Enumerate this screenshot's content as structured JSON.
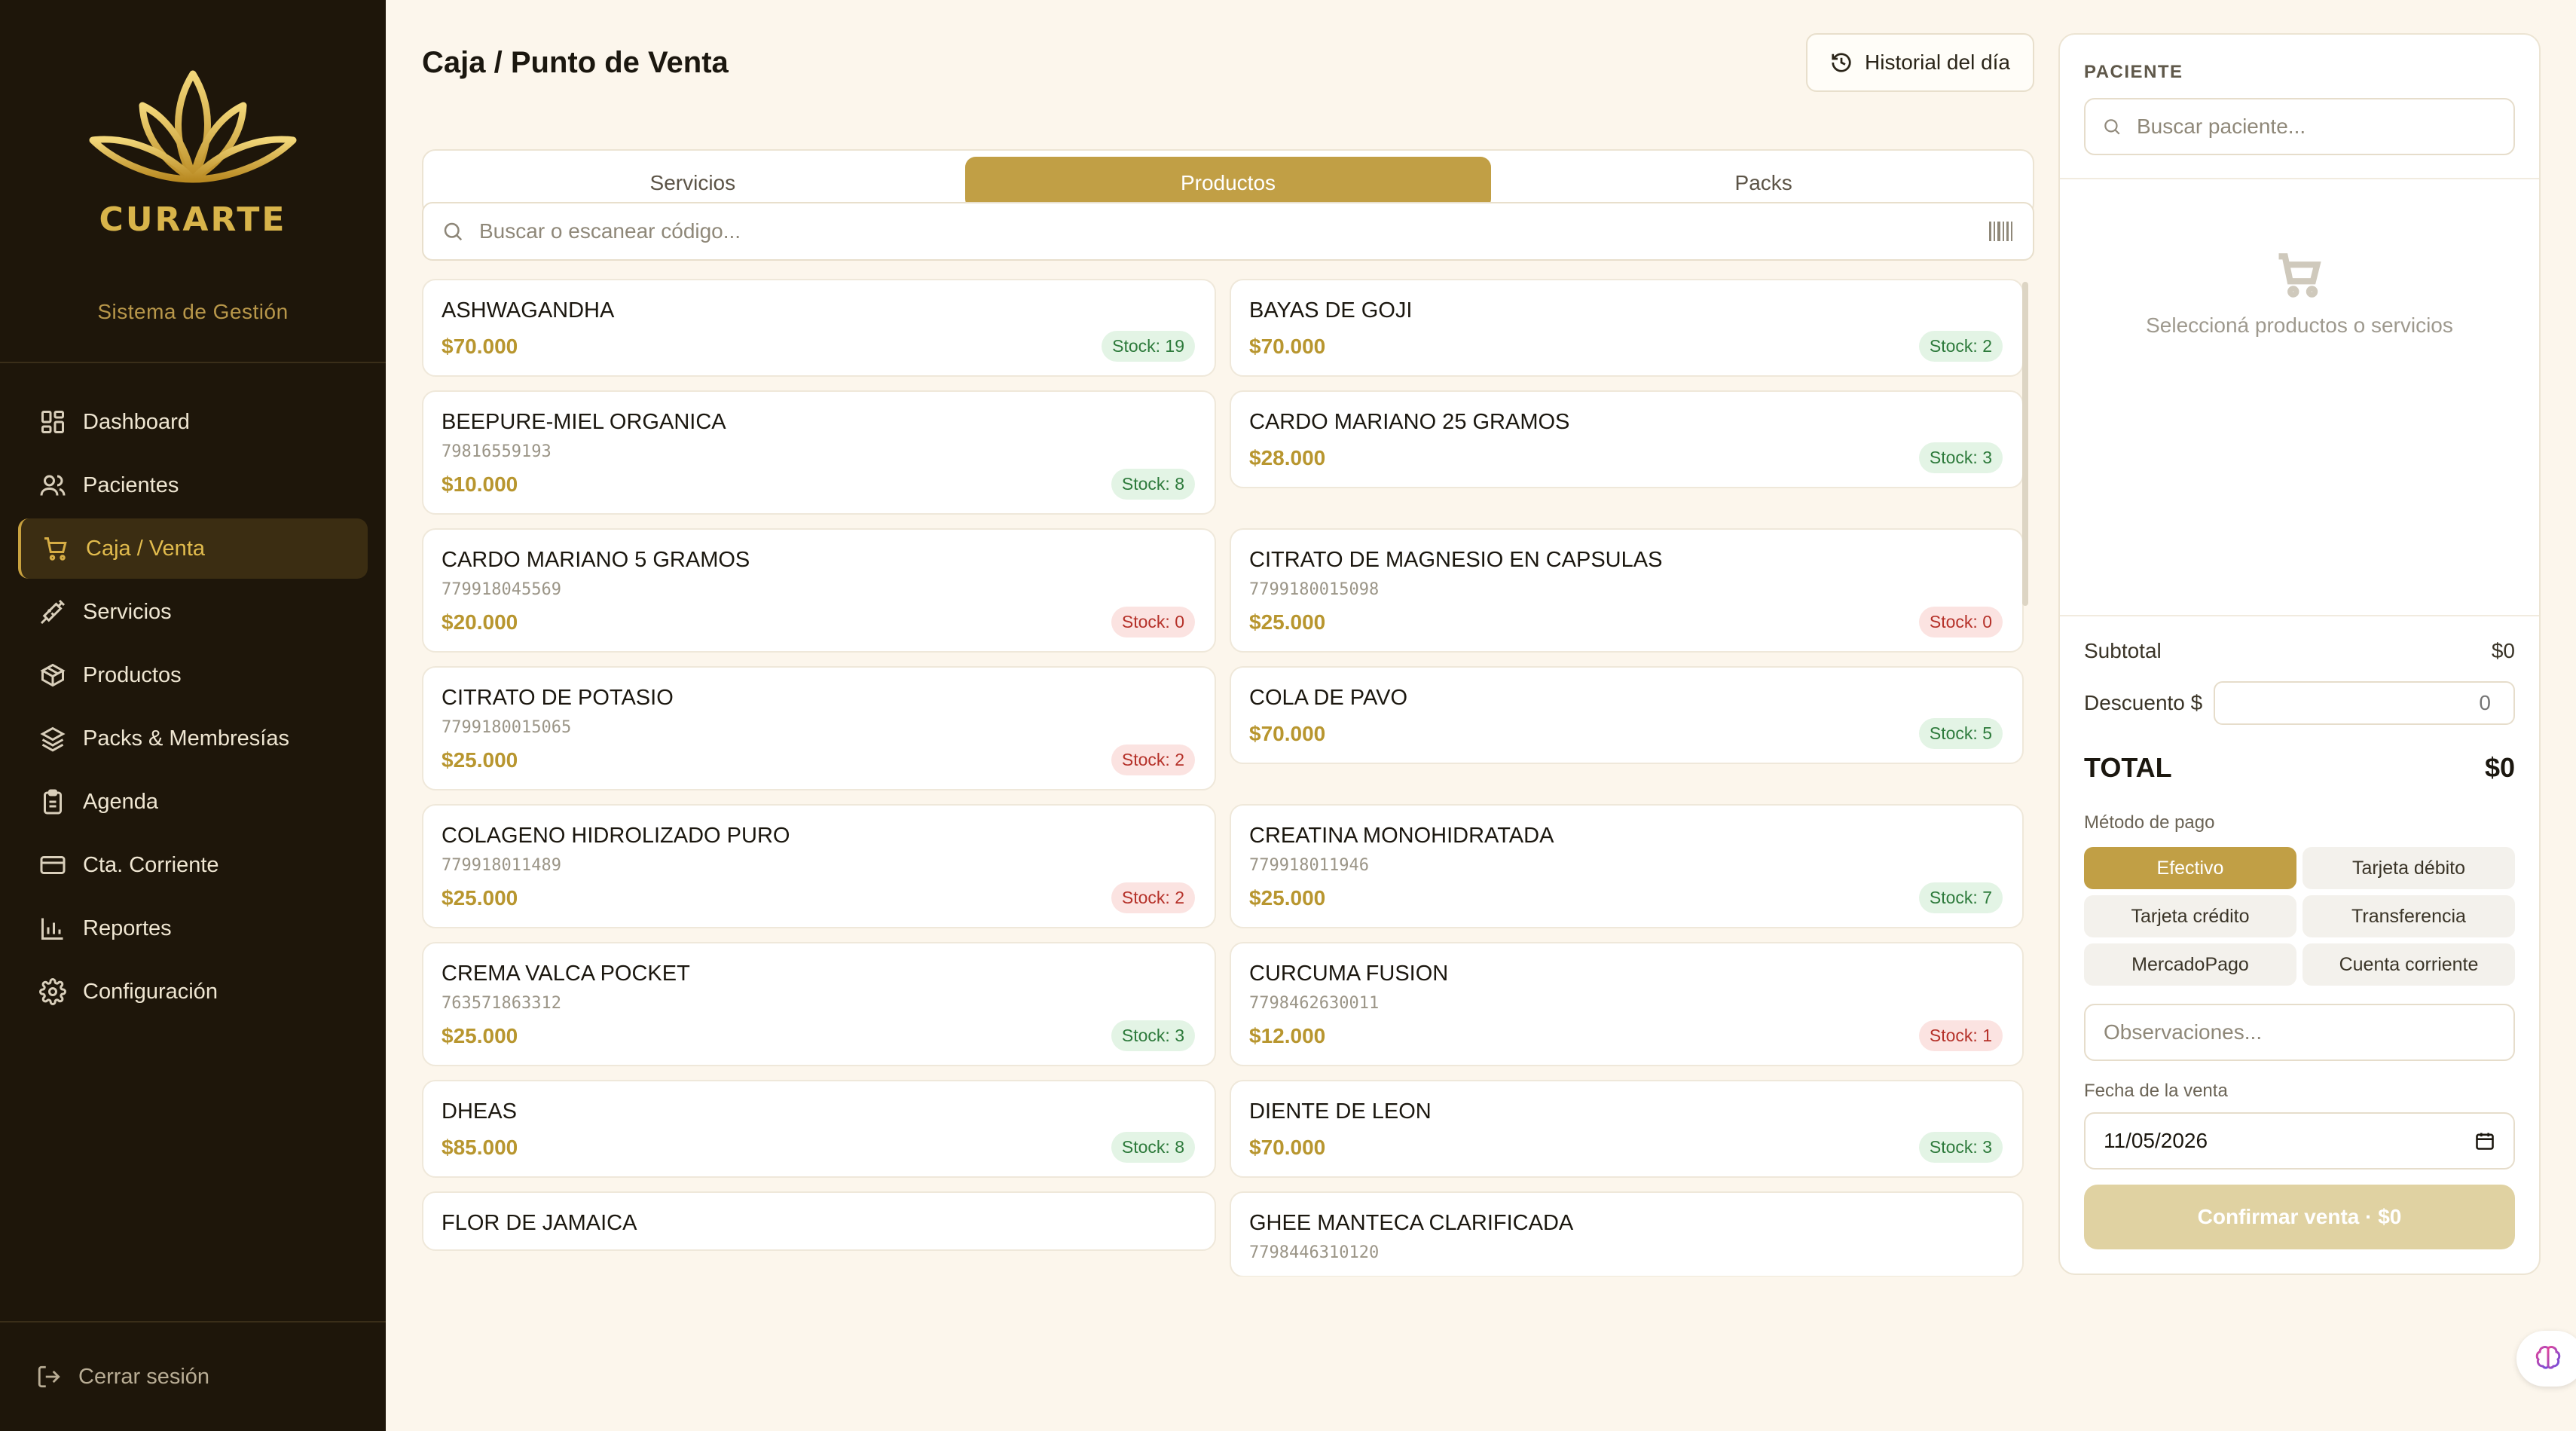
{
  "brand": {
    "name": "CURARTE",
    "subtitle": "Sistema de Gestión",
    "accent": "#c19f45"
  },
  "sidebar": {
    "items": [
      {
        "label": "Dashboard",
        "icon": "dashboard-icon",
        "active": false
      },
      {
        "label": "Pacientes",
        "icon": "users-icon",
        "active": false
      },
      {
        "label": "Caja / Venta",
        "icon": "cart-icon",
        "active": true
      },
      {
        "label": "Servicios",
        "icon": "syringe-icon",
        "active": false
      },
      {
        "label": "Productos",
        "icon": "box-icon",
        "active": false
      },
      {
        "label": "Packs & Membresías",
        "icon": "layers-icon",
        "active": false
      },
      {
        "label": "Agenda",
        "icon": "clipboard-icon",
        "active": false
      },
      {
        "label": "Cta. Corriente",
        "icon": "credit-card-icon",
        "active": false
      },
      {
        "label": "Reportes",
        "icon": "bar-chart-icon",
        "active": false
      },
      {
        "label": "Configuración",
        "icon": "gear-icon",
        "active": false
      }
    ],
    "logout_label": "Cerrar sesión"
  },
  "header": {
    "title": "Caja / Punto de Venta",
    "history_label": "Historial del día"
  },
  "tabs": [
    {
      "label": "Servicios",
      "active": false
    },
    {
      "label": "Productos",
      "active": true
    },
    {
      "label": "Packs",
      "active": false
    }
  ],
  "search": {
    "placeholder": "Buscar o escanear código..."
  },
  "products": [
    {
      "name": "ASHWAGANDHA",
      "code": "",
      "price": "$70.000",
      "stock": "Stock: 19",
      "status": "ok"
    },
    {
      "name": "BAYAS DE GOJI",
      "code": "",
      "price": "$70.000",
      "stock": "Stock: 2",
      "status": "ok"
    },
    {
      "name": "BEEPURE-MIEL ORGANICA",
      "code": "79816559193",
      "price": "$10.000",
      "stock": "Stock: 8",
      "status": "ok"
    },
    {
      "name": "CARDO MARIANO 25 GRAMOS",
      "code": "",
      "price": "$28.000",
      "stock": "Stock: 3",
      "status": "ok"
    },
    {
      "name": "CARDO MARIANO 5 GRAMOS",
      "code": "779918045569",
      "price": "$20.000",
      "stock": "Stock: 0",
      "status": "out"
    },
    {
      "name": "CITRATO DE MAGNESIO EN CAPSULAS",
      "code": "7799180015098",
      "price": "$25.000",
      "stock": "Stock: 0",
      "status": "out"
    },
    {
      "name": "CITRATO DE POTASIO",
      "code": "7799180015065",
      "price": "$25.000",
      "stock": "Stock: 2",
      "status": "out"
    },
    {
      "name": "COLA DE PAVO",
      "code": "",
      "price": "$70.000",
      "stock": "Stock: 5",
      "status": "ok"
    },
    {
      "name": "COLAGENO HIDROLIZADO PURO",
      "code": "779918011489",
      "price": "$25.000",
      "stock": "Stock: 2",
      "status": "out"
    },
    {
      "name": "CREATINA MONOHIDRATADA",
      "code": "779918011946",
      "price": "$25.000",
      "stock": "Stock: 7",
      "status": "ok"
    },
    {
      "name": "CREMA VALCA POCKET",
      "code": "763571863312",
      "price": "$25.000",
      "stock": "Stock: 3",
      "status": "ok"
    },
    {
      "name": "CURCUMA FUSION",
      "code": "7798462630011",
      "price": "$12.000",
      "stock": "Stock: 1",
      "status": "out"
    },
    {
      "name": "DHEAS",
      "code": "",
      "price": "$85.000",
      "stock": "Stock: 8",
      "status": "ok"
    },
    {
      "name": "DIENTE DE LEON",
      "code": "",
      "price": "$70.000",
      "stock": "Stock: 3",
      "status": "ok"
    },
    {
      "name": "FLOR DE JAMAICA",
      "code": "",
      "price": "",
      "stock": "",
      "status": "ok"
    },
    {
      "name": "GHEE MANTECA CLARIFICADA",
      "code": "7798446310120",
      "price": "",
      "stock": "",
      "status": "ok"
    }
  ],
  "panel": {
    "patient_label": "PACIENTE",
    "patient_placeholder": "Buscar paciente...",
    "empty_cart": "Seleccioná productos o servicios",
    "subtotal_label": "Subtotal",
    "subtotal_value": "$0",
    "discount_label": "Descuento $",
    "discount_placeholder": "0",
    "total_label": "TOTAL",
    "total_value": "$0",
    "payment_label": "Método de pago",
    "payment_methods": [
      {
        "label": "Efectivo",
        "active": true
      },
      {
        "label": "Tarjeta débito",
        "active": false
      },
      {
        "label": "Tarjeta crédito",
        "active": false
      },
      {
        "label": "Transferencia",
        "active": false
      },
      {
        "label": "MercadoPago",
        "active": false
      },
      {
        "label": "Cuenta corriente",
        "active": false
      }
    ],
    "notes_placeholder": "Observaciones...",
    "date_label": "Fecha de la venta",
    "date_value": "11/05/2026",
    "confirm_label": "Confirmar venta · $0"
  }
}
